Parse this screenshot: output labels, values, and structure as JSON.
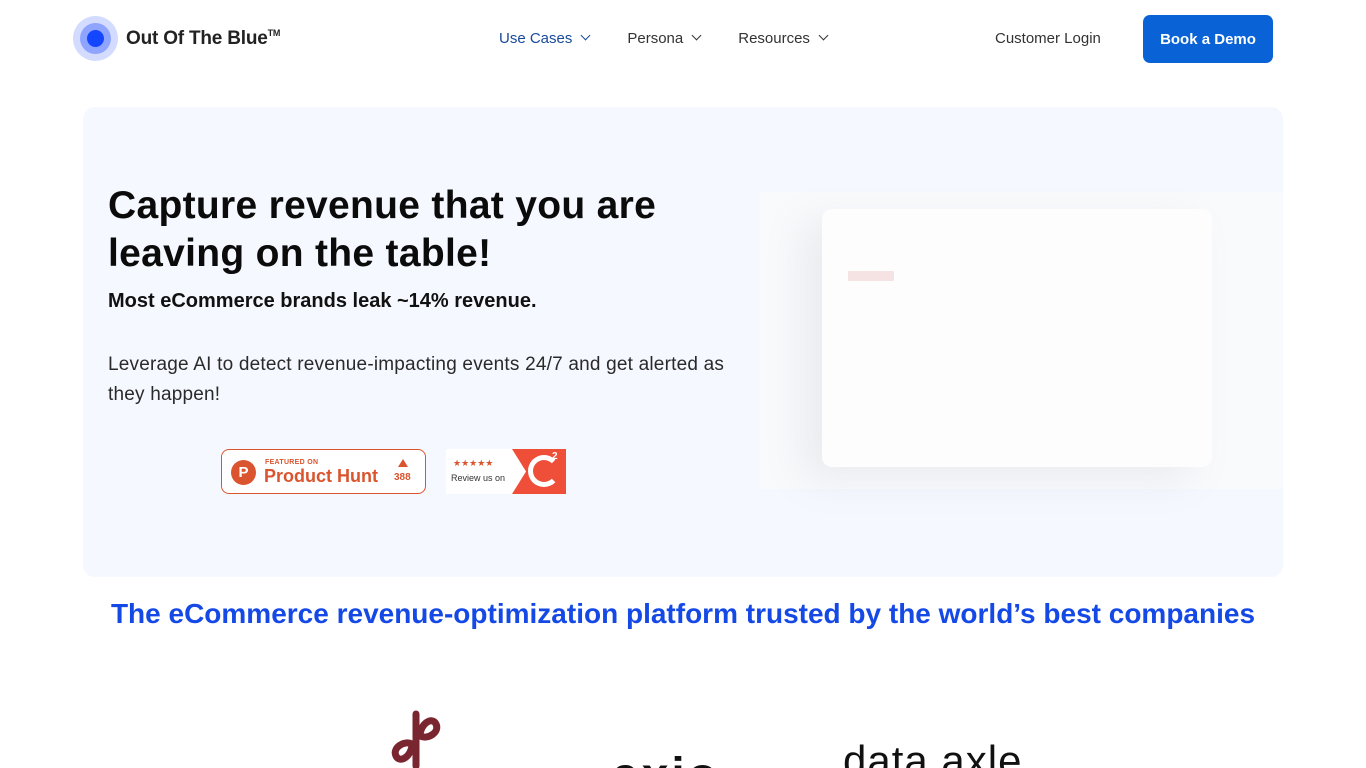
{
  "header": {
    "brand": "Out Of The Blue",
    "brand_tm": "TM",
    "nav": [
      {
        "label": "Use Cases",
        "icon": "chevron-down-icon"
      },
      {
        "label": "Persona",
        "icon": "chevron-down-icon"
      },
      {
        "label": "Resources",
        "icon": "chevron-down-icon"
      }
    ],
    "login_label": "Customer Login",
    "demo_label": "Book a Demo"
  },
  "hero": {
    "title": "Capture revenue that you are leaving on the table!",
    "subtitle": "Most eCommerce brands leak ~14% revenue.",
    "description": "Leverage AI to detect revenue-impacting events 24/7 and get alerted as they happen!",
    "product_hunt": {
      "featured": "FEATURED ON",
      "name": "Product Hunt",
      "count": "388",
      "letter": "P"
    },
    "g2": {
      "stars": "★★★★★",
      "review": "Review us on",
      "superscript": "2"
    }
  },
  "trusted": {
    "heading": "The eCommerce revenue-optimization platform trusted by the world’s best companies"
  },
  "client_logos": [
    {
      "name": "poshmark-logo"
    },
    {
      "name": "axio-logo",
      "text": "axio"
    },
    {
      "name": "data-axle-logo",
      "text": "data axle"
    }
  ],
  "colors": {
    "accent": "#0a63d6",
    "heading_blue": "#1549e6",
    "hero_bg": "#f5f8fe",
    "product_hunt": "#da552f",
    "g2": "#ef4f38"
  }
}
